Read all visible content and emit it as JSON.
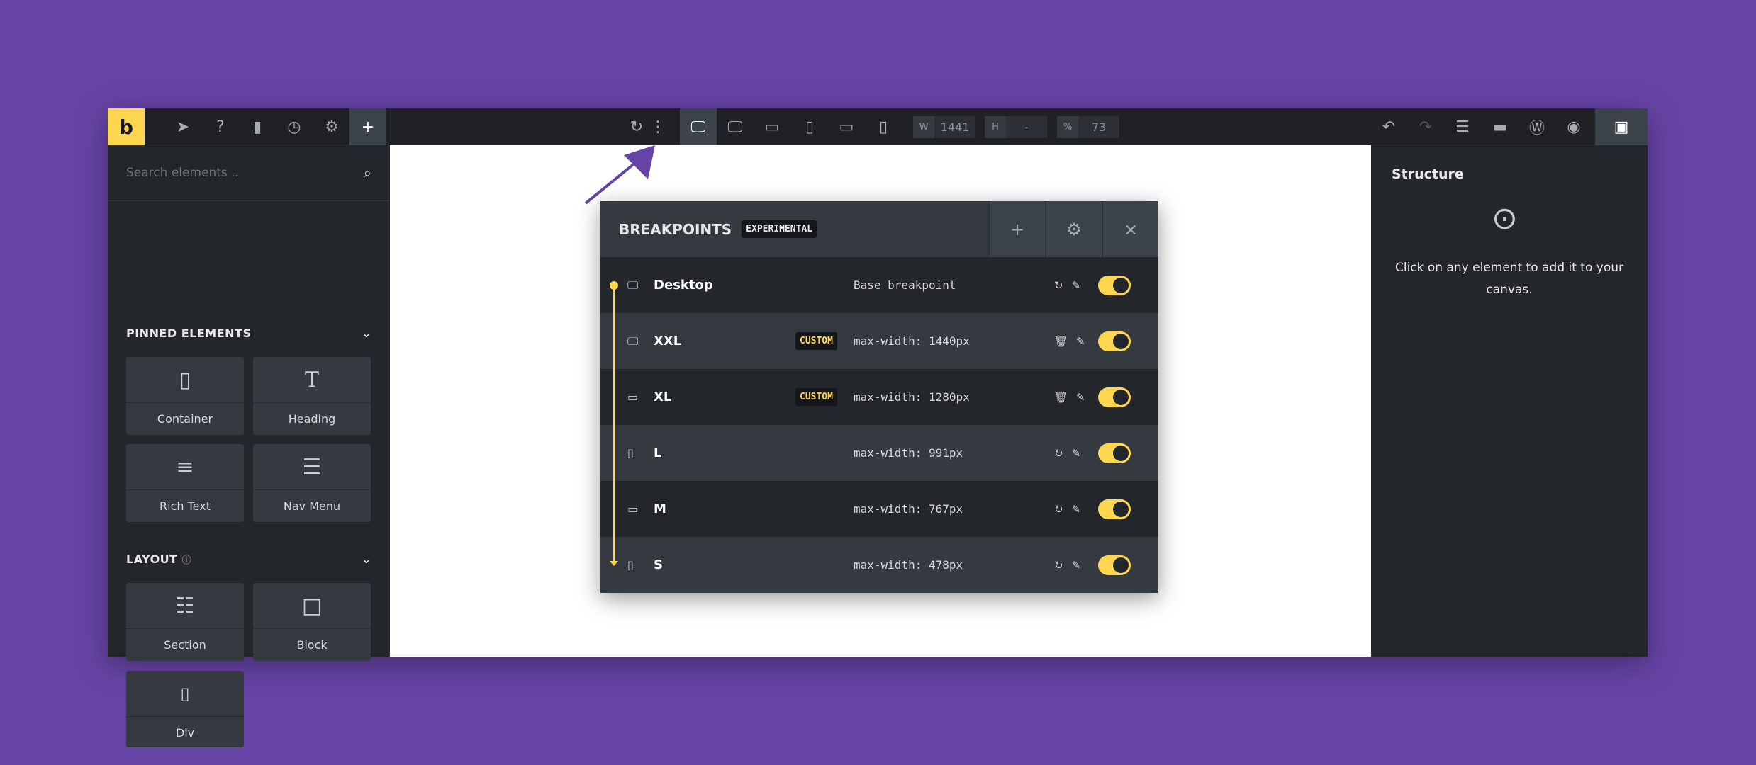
{
  "colors": {
    "accent": "#ffd64f",
    "background": "#6644a6",
    "panel": "#23262b"
  },
  "toolbar": {
    "logo": "b",
    "left_icons": [
      "cursor-icon",
      "help-icon",
      "page-icon",
      "history-icon",
      "settings-icon",
      "add-icon"
    ],
    "add": "+",
    "reload": "↻",
    "more": "⋮",
    "devices": [
      "desktop-icon",
      "desktop-xxl-icon",
      "laptop-icon",
      "tablet-portrait-icon",
      "tablet-landscape-icon",
      "mobile-icon"
    ],
    "width_label": "W",
    "width_value": "1441",
    "height_label": "H",
    "height_value": "-",
    "zoom_label": "%",
    "zoom_value": "73",
    "right_icons": [
      "undo-icon",
      "redo-icon",
      "layers-icon",
      "folder-icon",
      "wordpress-icon",
      "preview-icon",
      "save-icon"
    ]
  },
  "sidebar": {
    "search_placeholder": "Search elements ..",
    "pinned_title": "PINNED ELEMENTS",
    "layout_title": "LAYOUT",
    "pinned": [
      {
        "label": "Container",
        "icon": "container-icon"
      },
      {
        "label": "Heading",
        "icon": "heading-icon"
      },
      {
        "label": "Rich Text",
        "icon": "rich-text-icon"
      },
      {
        "label": "Nav Menu",
        "icon": "nav-menu-icon"
      }
    ],
    "layout": [
      {
        "label": "Section",
        "icon": "section-icon"
      },
      {
        "label": "Block",
        "icon": "block-icon"
      },
      {
        "label": "Div",
        "icon": "div-icon"
      }
    ]
  },
  "structure": {
    "title": "Structure",
    "hint": "Click on any element to add it to your canvas."
  },
  "breakpoints": {
    "title": "BREAKPOINTS",
    "badge": "EXPERIMENTAL",
    "add": "+",
    "close": "×",
    "rows": [
      {
        "name": "Desktop",
        "value": "Base breakpoint",
        "custom": "",
        "enabled": true,
        "action": "reset"
      },
      {
        "name": "XXL",
        "value": "max-width: 1440px",
        "custom": "CUSTOM",
        "enabled": true,
        "action": "delete"
      },
      {
        "name": "XL",
        "value": "max-width: 1280px",
        "custom": "CUSTOM",
        "enabled": true,
        "action": "delete"
      },
      {
        "name": "L",
        "value": "max-width: 991px",
        "custom": "",
        "enabled": true,
        "action": "reset"
      },
      {
        "name": "M",
        "value": "max-width: 767px",
        "custom": "",
        "enabled": true,
        "action": "reset"
      },
      {
        "name": "S",
        "value": "max-width: 478px",
        "custom": "",
        "enabled": true,
        "action": "reset"
      }
    ]
  }
}
